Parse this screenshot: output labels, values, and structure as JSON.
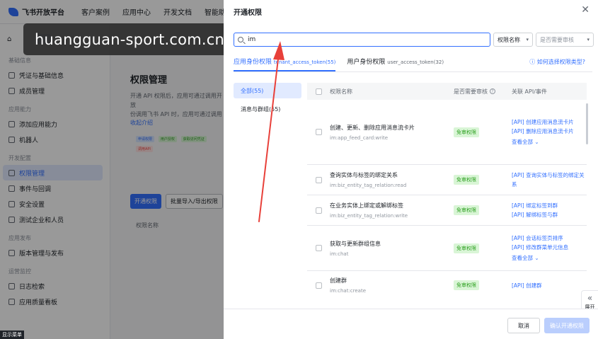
{
  "topnav": {
    "brand": "飞书开放平台",
    "links": [
      "客户案例",
      "应用中心",
      "开发文档",
      "智能助手"
    ]
  },
  "sidebar": {
    "groups": [
      {
        "title": "基础信息",
        "items": [
          "凭证与基础信息",
          "成员管理"
        ]
      },
      {
        "title": "应用能力",
        "items": [
          "添加应用能力",
          "机器人"
        ]
      },
      {
        "title": "开发配置",
        "items": [
          "权限管理",
          "事件与回调",
          "安全设置",
          "测试企业和人员"
        ]
      },
      {
        "title": "应用发布",
        "items": [
          "版本管理与发布"
        ]
      },
      {
        "title": "运营监控",
        "items": [
          "日志检索",
          "应用质量看板"
        ]
      }
    ],
    "show_menu": "显示菜单"
  },
  "main": {
    "title": "权限管理",
    "desc_lines": [
      "开通 API 权限后，应用可通过调用开放",
      "份调用飞书 API 时，应用可通过调用"
    ],
    "collapse": "收起介绍",
    "flow_tags": [
      "申请权限",
      "用户授权",
      "获取访问凭证",
      "调用API"
    ],
    "btn_enable": "开通权限",
    "btn_batch": "批量导入/导出权限",
    "table_header": "权限名称"
  },
  "watermark": "huangguan-sport.com.cn",
  "drawer": {
    "title": "开通权限",
    "close": "✕",
    "search": {
      "value": "im"
    },
    "select_scope": "权限名称",
    "select_audit": "是否需要审核",
    "tabs": [
      {
        "label": "应用身份权限",
        "sub": "tenant_access_token(55)"
      },
      {
        "label": "用户身份权限",
        "sub": "user_access_token(32)"
      }
    ],
    "help_link": "如何选择权限类型?",
    "categories": [
      "全部(55)",
      "消息与群组(55)"
    ],
    "columns": [
      "权限名称",
      "是否需要审核",
      "关联 API/事件"
    ],
    "audit_label": "免审权限",
    "rows": [
      {
        "name": "创建、更新、删除应用消息流卡片",
        "key": "im:app_feed_card:write",
        "apis": [
          "[API] 创建应用消息流卡片",
          "[API] 删除应用消息流卡片"
        ],
        "more": "查看全部"
      },
      {
        "name": "查询实体与标签的绑定关系",
        "key": "im:biz_entity_tag_relation:read",
        "apis": [
          "[API] 查询实体与标签的绑定关系"
        ],
        "more": ""
      },
      {
        "name": "在业务实体上绑定或解绑标签",
        "key": "im:biz_entity_tag_relation:write",
        "apis": [
          "[API] 绑定标签到群",
          "[API] 解绑标签与群"
        ],
        "more": ""
      },
      {
        "name": "获取与更新群组信息",
        "key": "im:chat",
        "apis": [
          "[API] 会话标签页排序",
          "[API] 修改群菜单元信息"
        ],
        "more": "查看全部"
      },
      {
        "name": "创建群",
        "key": "im:chat:create",
        "apis": [
          "[API] 创建群"
        ],
        "more": ""
      }
    ],
    "expand": "展开",
    "cancel": "取消",
    "confirm": "确认开通权限"
  },
  "colors": {
    "accent": "#3370ff",
    "audit_bg": "#d9f5d6",
    "audit_text": "#2ea121",
    "annotation_arrow": "#e8403a"
  }
}
